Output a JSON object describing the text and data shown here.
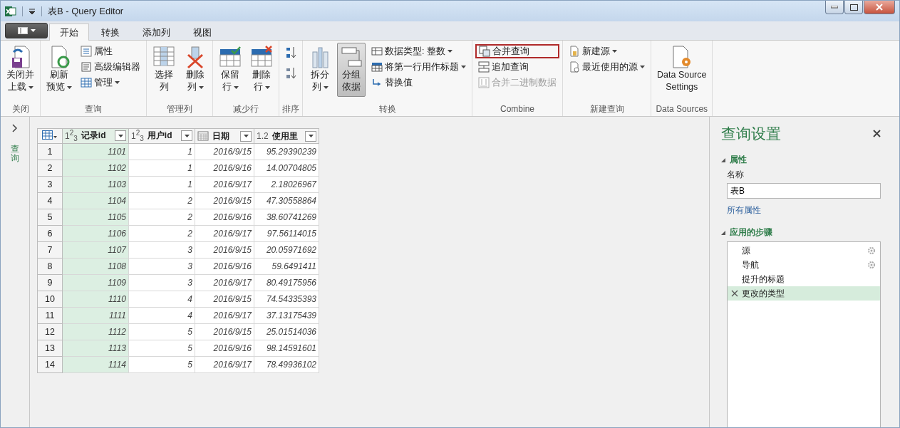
{
  "window": {
    "title": "表B - Query Editor"
  },
  "ribbon_tabs": [
    {
      "label": "开始",
      "selected": true
    },
    {
      "label": "转换",
      "selected": false
    },
    {
      "label": "添加列",
      "selected": false
    },
    {
      "label": "视图",
      "selected": false
    }
  ],
  "ribbon_groups": [
    {
      "label": "关闭",
      "items": [
        {
          "kind": "large",
          "lines": [
            "关闭并",
            "上载"
          ],
          "dropdown": true
        }
      ]
    },
    {
      "label": "查询",
      "items": [
        {
          "kind": "large",
          "lines": [
            "刷新",
            "预览"
          ],
          "dropdown": true
        },
        {
          "kind": "small",
          "label": "属性",
          "dropdown": false
        },
        {
          "kind": "small",
          "label": "高级编辑器",
          "dropdown": false
        },
        {
          "kind": "small",
          "label": "管理",
          "dropdown": true
        }
      ]
    },
    {
      "label": "管理列",
      "items": [
        {
          "kind": "large",
          "lines": [
            "选择",
            "列"
          ],
          "dropdown": false
        },
        {
          "kind": "large",
          "lines": [
            "删除",
            "列"
          ],
          "dropdown": true
        }
      ]
    },
    {
      "label": "减少行",
      "items": [
        {
          "kind": "large",
          "lines": [
            "保留",
            "行"
          ],
          "dropdown": true
        },
        {
          "kind": "large",
          "lines": [
            "删除",
            "行"
          ],
          "dropdown": true
        }
      ]
    },
    {
      "label": "排序",
      "items": [
        {
          "kind": "icon"
        },
        {
          "kind": "icon"
        }
      ]
    },
    {
      "label": "转换",
      "items": [
        {
          "kind": "large",
          "lines": [
            "拆分",
            "列"
          ],
          "dropdown": true
        },
        {
          "kind": "large",
          "lines": [
            "分组",
            "依据"
          ],
          "dropdown": false,
          "selected": true
        },
        {
          "kind": "small",
          "label": "数据类型: 整数",
          "dropdown": true
        },
        {
          "kind": "small",
          "label": "将第一行用作标题",
          "dropdown": true
        },
        {
          "kind": "small",
          "label": "替换值",
          "dropdown": false
        }
      ]
    },
    {
      "label": "Combine",
      "items": [
        {
          "kind": "small",
          "label": "合并查询",
          "dropdown": false,
          "highlighted": true
        },
        {
          "kind": "small",
          "label": "追加查询",
          "dropdown": false
        },
        {
          "kind": "small",
          "label": "合并二进制数据",
          "dropdown": false,
          "disabled": true
        }
      ]
    },
    {
      "label": "新建查询",
      "items": [
        {
          "kind": "small",
          "label": "新建源",
          "dropdown": true
        },
        {
          "kind": "small",
          "label": "最近使用的源",
          "dropdown": true
        }
      ]
    },
    {
      "label": "Data Sources",
      "items": [
        {
          "kind": "large",
          "lines": [
            "Data Source",
            "Settings"
          ],
          "dropdown": false
        }
      ]
    }
  ],
  "queries_pane": {
    "label": "查询"
  },
  "table": {
    "columns": [
      {
        "kind": "integer",
        "type_label": "1$^{2}$$_{3}$",
        "name": "记录id",
        "selected": true
      },
      {
        "kind": "integer",
        "type_label": "1$^{2}$$_{3}$",
        "name": "用户id",
        "selected": false
      },
      {
        "kind": "date",
        "name": "日期",
        "selected": false
      },
      {
        "kind": "decimal",
        "type_label": "1.2",
        "name": "使用里",
        "selected": false
      }
    ],
    "rows": [
      {
        "number": "1",
        "cells": [
          "1101",
          "1",
          "2016/9/15",
          "95.29390239"
        ]
      },
      {
        "number": "2",
        "cells": [
          "1102",
          "1",
          "2016/9/16",
          "14.00704805"
        ]
      },
      {
        "number": "3",
        "cells": [
          "1103",
          "1",
          "2016/9/17",
          "2.18026967"
        ]
      },
      {
        "number": "4",
        "cells": [
          "1104",
          "2",
          "2016/9/15",
          "47.30558864"
        ]
      },
      {
        "number": "5",
        "cells": [
          "1105",
          "2",
          "2016/9/16",
          "38.60741269"
        ]
      },
      {
        "number": "6",
        "cells": [
          "1106",
          "2",
          "2016/9/17",
          "97.56114015"
        ]
      },
      {
        "number": "7",
        "cells": [
          "1107",
          "3",
          "2016/9/15",
          "20.05971692"
        ]
      },
      {
        "number": "8",
        "cells": [
          "1108",
          "3",
          "2016/9/16",
          "59.6491411"
        ]
      },
      {
        "number": "9",
        "cells": [
          "1109",
          "3",
          "2016/9/17",
          "80.49175956"
        ]
      },
      {
        "number": "10",
        "cells": [
          "1110",
          "4",
          "2016/9/15",
          "74.54335393"
        ]
      },
      {
        "number": "11",
        "cells": [
          "1111",
          "4",
          "2016/9/17",
          "37.13175439"
        ]
      },
      {
        "number": "12",
        "cells": [
          "1112",
          "5",
          "2016/9/15",
          "25.01514036"
        ]
      },
      {
        "number": "13",
        "cells": [
          "1113",
          "5",
          "2016/9/16",
          "98.14591601"
        ]
      },
      {
        "number": "14",
        "cells": [
          "1114",
          "5",
          "2016/9/17",
          "78.49936102"
        ]
      }
    ]
  },
  "query_settings": {
    "title": "查询设置",
    "properties_heading": "属性",
    "name_label": "名称",
    "name_value": "表B",
    "all_properties_link": "所有属性",
    "steps_heading": "应用的步骤",
    "steps": [
      {
        "label": "源",
        "has_settings": true,
        "selected": false
      },
      {
        "label": "导航",
        "has_settings": true,
        "selected": false
      },
      {
        "label": "提升的标题",
        "has_settings": false,
        "selected": false
      },
      {
        "label": "更改的类型",
        "has_settings": false,
        "selected": true
      }
    ]
  }
}
